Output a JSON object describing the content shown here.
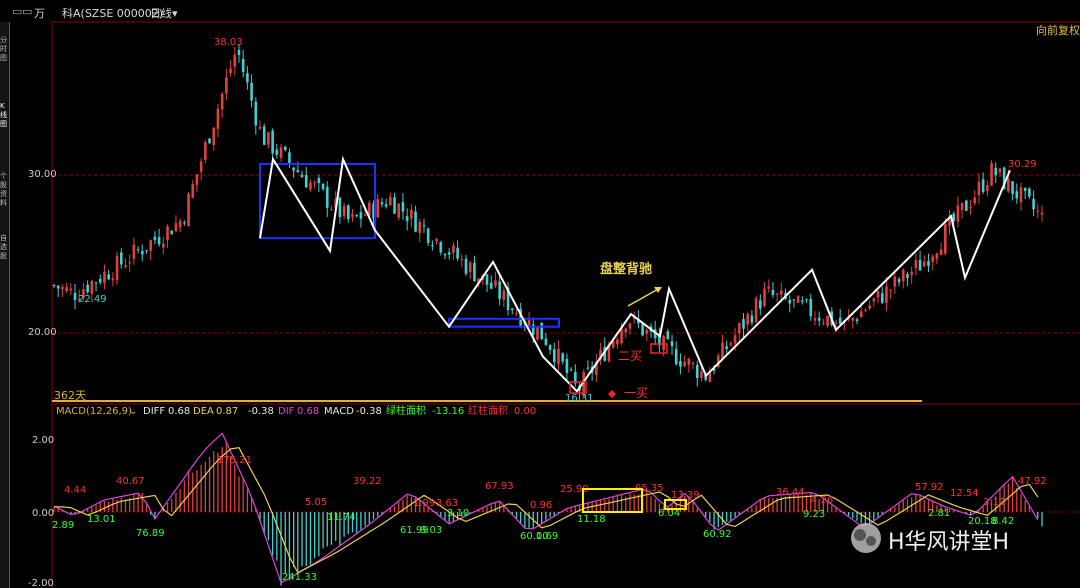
{
  "toolbar": {
    "icons": [
      "window-icon",
      "window-icon"
    ],
    "brand": "万",
    "stock": "科A(SZSE 000002)",
    "period": "日线",
    "adjust": "向前复权"
  },
  "sidebar": {
    "items": [
      "分时图",
      "K线图",
      "个股资料",
      "自选股"
    ]
  },
  "colors": {
    "up": "#e04040",
    "down": "#3fd1d1",
    "zigzag": "#ffffff",
    "box": "#2030ff",
    "highlight": "#ffee00",
    "diff": "#e8e8e8",
    "dea": "#e8d34a",
    "dif": "#e040e0",
    "ma_line": "#e0b030",
    "grid": "#8b0000",
    "label_red": "#ff3030",
    "label_green": "#30ff30"
  },
  "main_chart": {
    "ylabels": [
      "30.00",
      "20.00"
    ],
    "price_labels": [
      "38.03",
      "22.49",
      "30.29",
      "16.31"
    ],
    "annotations": {
      "divergence": "盘整背驰",
      "buy1": "一买",
      "buy2": "二买",
      "span": "362天"
    }
  },
  "macd_panel": {
    "header": {
      "title": "MACD(12,26,9)",
      "diff_label": "DIFF",
      "diff_value": "0.68",
      "dea_label": "DEA",
      "dea_value": "0.87",
      "hist_value": "-0.38",
      "dif_label": "DIF",
      "dif_value": "0.68",
      "macd_label": "MACD",
      "macd_value": "-0.38",
      "green_area_label": "绿柱面积",
      "green_area_value": "-13.16",
      "red_area_label": "红柱面积",
      "red_area_value": "0.00"
    },
    "ylabels": [
      "2.00",
      "0.00",
      "-2.00"
    ],
    "red_labels": [
      "4.44",
      "40.67",
      "175.21",
      "5.05",
      "39.22",
      "1.99",
      "3.63",
      "67.93",
      "0.96",
      "25.90",
      "65.35",
      "13.39",
      "36.44",
      "4.26",
      "57.92",
      "12.54",
      "3.13",
      "47.92"
    ],
    "green_labels": [
      "2.89",
      "13.01",
      "76.89",
      "241.33",
      "11.74",
      "61.99",
      "9.03",
      "3.10",
      "60.10",
      "0.69",
      "11.18",
      "6.04",
      "60.92",
      "9.23",
      "2.81",
      "20.18",
      "8.42"
    ]
  },
  "watermark": {
    "text": "H华风讲堂H"
  },
  "chart_data": {
    "type": "candlestick",
    "title": "科A(SZSE 000002) 日线",
    "ylabel": "",
    "ylim": [
      14.8,
      40.5
    ],
    "yticks": [
      20,
      30
    ],
    "key_points": [
      {
        "label": "start",
        "price": 23.0
      },
      {
        "label": "low",
        "price": 22.49
      },
      {
        "label": "high",
        "price": 38.03
      },
      {
        "label": "low",
        "price": 16.31
      },
      {
        "label": "high",
        "price": 30.29
      },
      {
        "label": "end",
        "price": 27.3
      }
    ],
    "zigzag_prices": [
      26.0,
      31.0,
      25.2,
      31.0,
      26.5,
      20.4,
      24.5,
      18.5,
      16.31,
      21.2,
      19.8,
      22.8,
      17.3,
      24.0,
      20.2,
      27.4,
      23.5,
      30.29
    ],
    "boxes": [
      {
        "name": "central-zone-1",
        "price_range": [
          26.0,
          30.7
        ]
      },
      {
        "name": "central-zone-2",
        "price_range": [
          20.4,
          20.9
        ]
      }
    ],
    "macd": {
      "parameters": [
        12,
        26,
        9
      ],
      "dif": 0.68,
      "dea": 0.87,
      "macd": -0.38,
      "ylim": [
        -2.1,
        2.5
      ],
      "yticks": [
        2.0,
        0.0,
        -2.0
      ]
    }
  }
}
